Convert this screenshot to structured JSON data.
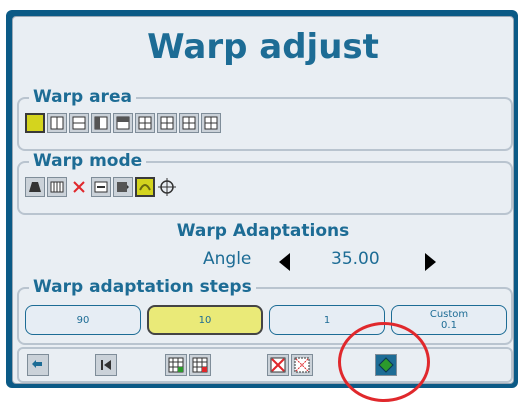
{
  "window": {
    "title": "Warp adjust"
  },
  "warp_area": {
    "label": "Warp area",
    "icons": [
      "full-area-icon",
      "split-vertical-2-icon",
      "split-horizontal-2-icon",
      "split-left-icon",
      "split-top-icon",
      "quad-grid-icon",
      "quad-grid-icon",
      "quad-grid-icon",
      "quad-grid-icon"
    ],
    "selected_index": 0
  },
  "warp_mode": {
    "label": "Warp mode",
    "icons": [
      "keystone-icon",
      "bars-icon",
      "cross-icon",
      "stretch-icon",
      "arrow-box-icon",
      "curve-icon",
      "crosshair-icon"
    ],
    "selected_index": 5
  },
  "adaptations": {
    "title": "Warp Adaptations",
    "parameter_label": "Angle",
    "parameter_value": "35.00"
  },
  "steps": {
    "label": "Warp adaptation steps",
    "options": [
      {
        "label": "90",
        "sub": ""
      },
      {
        "label": "10",
        "sub": ""
      },
      {
        "label": "1",
        "sub": ""
      },
      {
        "label": "Custom",
        "sub": "0.1"
      }
    ],
    "selected_index": 1
  },
  "toolbar": {
    "icons": [
      "back-icon",
      "skip-start-icon",
      "grid-add-icon",
      "grid-remove-icon",
      "grid-cross-icon",
      "grid-cross-dotted-icon",
      "reset-warp-icon"
    ]
  },
  "colors": {
    "accent": "#1d6c95",
    "highlight": "#d4d41e",
    "annotation": "#e0282c"
  }
}
